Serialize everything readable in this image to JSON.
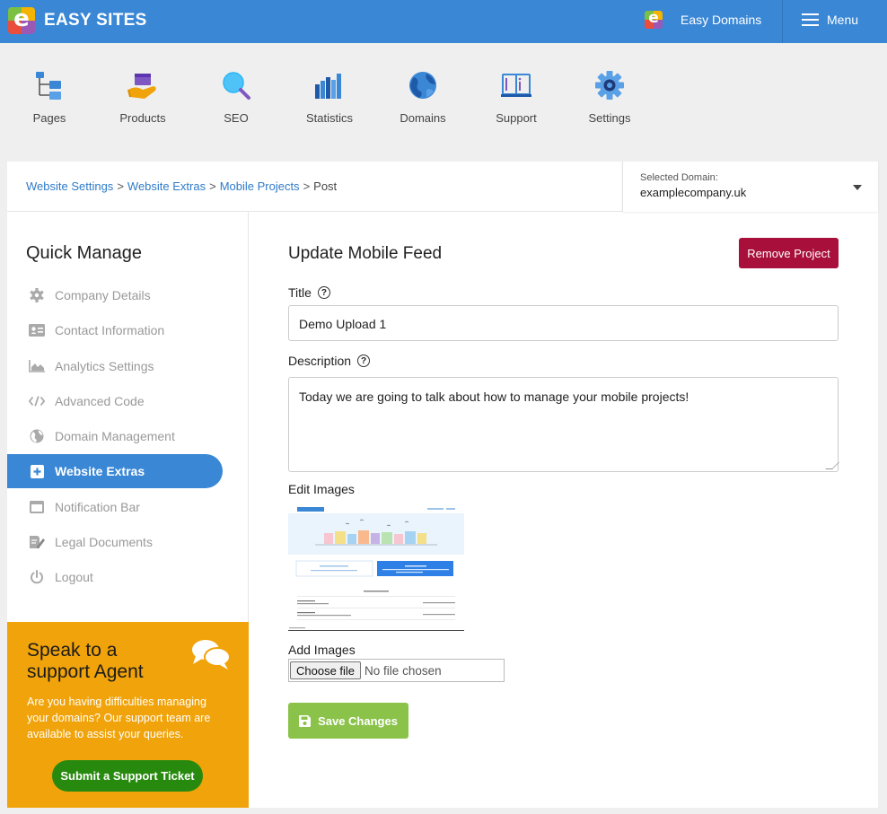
{
  "topbar": {
    "brand_name": "EASY SITES",
    "domains_label": "Easy Domains",
    "menu_label": "Menu"
  },
  "nav": [
    {
      "label": "Pages",
      "icon": "pages-icon"
    },
    {
      "label": "Products",
      "icon": "products-icon"
    },
    {
      "label": "SEO",
      "icon": "seo-icon"
    },
    {
      "label": "Statistics",
      "icon": "statistics-icon"
    },
    {
      "label": "Domains",
      "icon": "domains-icon"
    },
    {
      "label": "Support",
      "icon": "support-icon"
    },
    {
      "label": "Settings",
      "icon": "settings-icon"
    }
  ],
  "breadcrumb": {
    "items": [
      "Website Settings",
      "Website Extras",
      "Mobile Projects"
    ],
    "separator": ">",
    "current": "Post"
  },
  "domain_select": {
    "label": "Selected Domain:",
    "value": "examplecompany.uk"
  },
  "sidebar": {
    "title": "Quick Manage",
    "items": [
      {
        "label": "Company Details",
        "icon": "gear-icon",
        "active": false
      },
      {
        "label": "Contact Information",
        "icon": "contact-card-icon",
        "active": false
      },
      {
        "label": "Analytics Settings",
        "icon": "area-chart-icon",
        "active": false
      },
      {
        "label": "Advanced Code",
        "icon": "code-icon",
        "active": false
      },
      {
        "label": "Domain Management",
        "icon": "globe-icon",
        "active": false
      },
      {
        "label": "Website Extras",
        "icon": "plus-square-icon",
        "active": true
      },
      {
        "label": "Notification Bar",
        "icon": "window-icon",
        "active": false
      },
      {
        "label": "Legal Documents",
        "icon": "document-edit-icon",
        "active": false
      },
      {
        "label": "Logout",
        "icon": "power-icon",
        "active": false
      }
    ]
  },
  "support": {
    "title": "Speak to a support Agent",
    "text": "Are you having difficulties managing your domains? Our support team are available to assist your queries.",
    "button": "Submit a Support Ticket"
  },
  "main": {
    "title": "Update Mobile Feed",
    "remove_button": "Remove Project",
    "title_label": "Title",
    "title_value": "Demo Upload 1",
    "description_label": "Description",
    "description_value": "Today we are going to talk about how to manage your mobile projects!",
    "edit_images_label": "Edit Images",
    "add_images_label": "Add Images",
    "choose_file": "Choose file",
    "no_file": "No file chosen",
    "save_button": "Save Changes"
  },
  "colors": {
    "topbar": "#3a87d5",
    "active": "#3a87d5",
    "remove": "#a80f3a",
    "support_bg": "#f0a30a",
    "support_btn": "#278a0e",
    "save": "#8bc34a"
  }
}
